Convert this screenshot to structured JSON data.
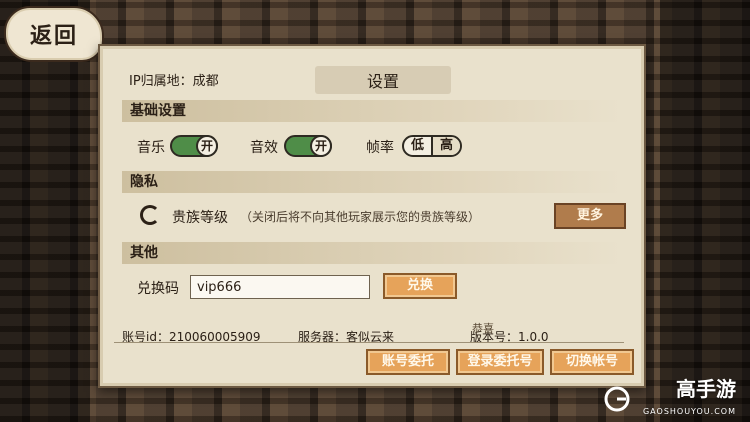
{
  "back": {
    "label": "返回"
  },
  "header": {
    "ip_label": "IP归属地：成都",
    "title": "设置"
  },
  "sections": {
    "basic": "基础设置",
    "privacy": "隐私",
    "other": "其他"
  },
  "basic": {
    "music_label": "音乐",
    "music_state": "开",
    "sfx_label": "音效",
    "sfx_state": "开",
    "fps_label": "帧率",
    "fps_low": "低",
    "fps_high": "高",
    "fps_selected": "高"
  },
  "privacy": {
    "noble_label": "贵族等级",
    "noble_note": "（关闭后将不向其他玩家展示您的贵族等级）",
    "more_button": "更多"
  },
  "other": {
    "code_label": "兑换码",
    "code_value": "vip666",
    "redeem_button": "兑换"
  },
  "footer": {
    "account_id": "账号id：210060005909",
    "server": "服务器：客似云来",
    "version": "版本号：1.0.0",
    "overlay_text": "恭喜"
  },
  "actions": {
    "entrust_button": "账号委托",
    "login_entrust_button": "登录委托号",
    "switch_button": "切换帐号"
  },
  "watermark": {
    "name": "高手游",
    "domain": "GAOSHOUYOU.COM"
  },
  "colors": {
    "toggle_on": "#4f8d48",
    "button_orange": "#e6a35a",
    "button_brown": "#b07c4c",
    "parchment": "#e9e1cc"
  }
}
